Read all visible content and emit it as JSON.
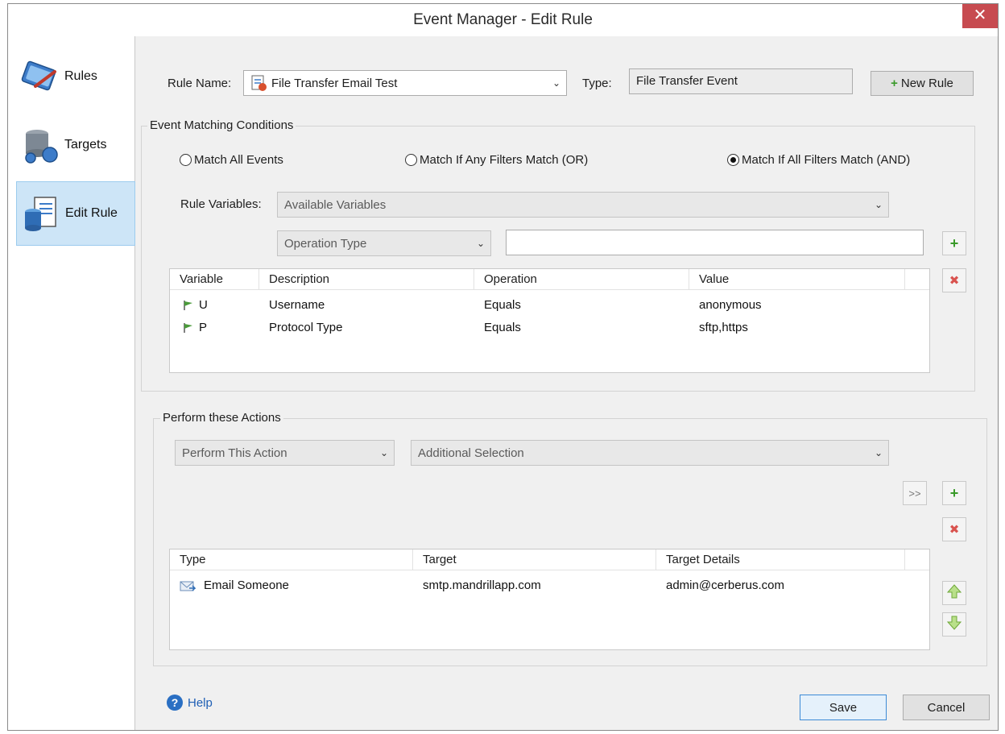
{
  "window": {
    "title": "Event Manager - Edit Rule",
    "close_glyph": "✕"
  },
  "sidebar": {
    "items": [
      {
        "label": "Rules",
        "icon": "rules-icon"
      },
      {
        "label": "Targets",
        "icon": "targets-icon"
      },
      {
        "label": "Edit Rule",
        "icon": "edit-rule-icon",
        "active": true
      }
    ]
  },
  "rule": {
    "name_label": "Rule Name:",
    "name_value": "File Transfer Email Test",
    "type_label": "Type:",
    "type_value": "File Transfer Event",
    "new_rule_label": "New Rule"
  },
  "conditions": {
    "group_title": "Event Matching Conditions",
    "radios": [
      {
        "label": "Match All Events",
        "selected": false
      },
      {
        "label": "Match If Any Filters Match (OR)",
        "selected": false
      },
      {
        "label": "Match If All Filters Match (AND)",
        "selected": true
      }
    ],
    "rule_variables_label": "Rule Variables:",
    "rule_variables_value": "Available Variables",
    "operation_type_value": "Operation Type",
    "value_input": "",
    "columns": [
      "Variable",
      "Description",
      "Operation",
      "Value"
    ],
    "rows": [
      {
        "variable": "U",
        "description": "Username",
        "operation": "Equals",
        "value": "anonymous"
      },
      {
        "variable": "P",
        "description": "Protocol Type",
        "operation": "Equals",
        "value": "sftp,https"
      }
    ]
  },
  "actions": {
    "group_title": "Perform these Actions",
    "perform_value": "Perform This Action",
    "additional_value": "Additional Selection",
    "move_label": ">>",
    "columns": [
      "Type",
      "Target",
      "Target Details"
    ],
    "rows": [
      {
        "type": "Email Someone",
        "target": "smtp.mandrillapp.com",
        "details": "admin@cerberus.com"
      }
    ]
  },
  "footer": {
    "help_label": "Help",
    "save_label": "Save",
    "cancel_label": "Cancel"
  },
  "colors": {
    "accent": "#3c8ad6",
    "close": "#c74b50",
    "add_green": "#3a9a2a",
    "remove_red": "#d9534f"
  }
}
